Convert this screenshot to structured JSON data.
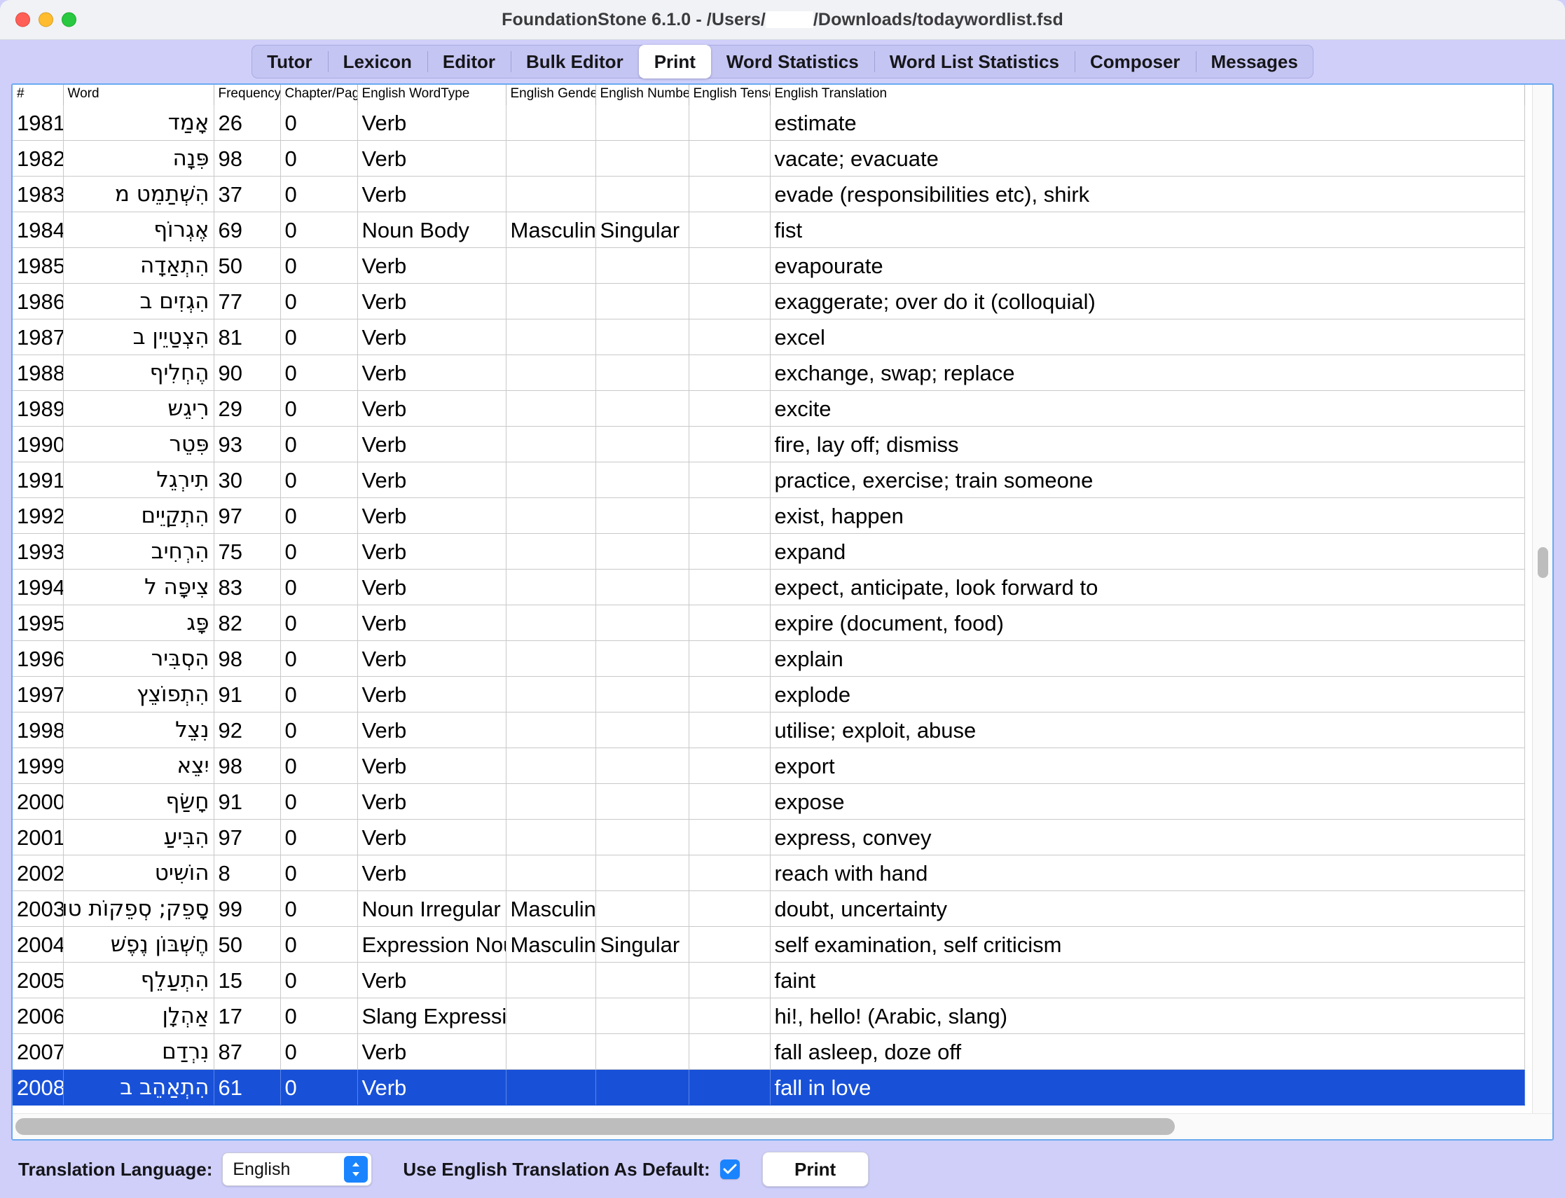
{
  "window": {
    "title_prefix": "FoundationStone 6.1.0 - /Users/",
    "title_suffix": "/Downloads/todaywordlist.fsd",
    "traffic_lights": [
      "close",
      "minimize",
      "zoom"
    ]
  },
  "tabs": [
    {
      "label": "Tutor",
      "active": false
    },
    {
      "label": "Lexicon",
      "active": false
    },
    {
      "label": "Editor",
      "active": false
    },
    {
      "label": "Bulk Editor",
      "active": false
    },
    {
      "label": "Print",
      "active": true
    },
    {
      "label": "Word Statistics",
      "active": false
    },
    {
      "label": "Word List Statistics",
      "active": false
    },
    {
      "label": "Composer",
      "active": false
    },
    {
      "label": "Messages",
      "active": false
    }
  ],
  "table": {
    "columns": [
      "#",
      "Word",
      "Frequency",
      "Chapter/Page",
      "English WordType",
      "English Gender",
      "English Number",
      "English Tense",
      "English Translation"
    ],
    "rows": [
      {
        "num": "1981",
        "word": "אָמַד",
        "freq": "26",
        "chap": "0",
        "type": "Verb",
        "gender": "",
        "number": "",
        "tense": "",
        "translation": "estimate",
        "selected": false
      },
      {
        "num": "1982",
        "word": "פִּנָה",
        "freq": "98",
        "chap": "0",
        "type": "Verb",
        "gender": "",
        "number": "",
        "tense": "",
        "translation": "vacate; evacuate",
        "selected": false
      },
      {
        "num": "1983",
        "word": "הִשְׁתַמֵט מ",
        "freq": "37",
        "chap": "0",
        "type": "Verb",
        "gender": "",
        "number": "",
        "tense": "",
        "translation": "evade (responsibilities etc), shirk",
        "selected": false
      },
      {
        "num": "1984",
        "word": "אֶגְרוֹף",
        "freq": "69",
        "chap": "0",
        "type": "Noun Body",
        "gender": "Masculine",
        "number": "Singular",
        "tense": "",
        "translation": "fist",
        "selected": false
      },
      {
        "num": "1985",
        "word": "הִתְאַדָה",
        "freq": "50",
        "chap": "0",
        "type": "Verb",
        "gender": "",
        "number": "",
        "tense": "",
        "translation": "evapourate",
        "selected": false
      },
      {
        "num": "1986",
        "word": "הִגְזִים ב",
        "freq": "77",
        "chap": "0",
        "type": "Verb",
        "gender": "",
        "number": "",
        "tense": "",
        "translation": "exaggerate; over do it (colloquial)",
        "selected": false
      },
      {
        "num": "1987",
        "word": "הִצְטַיֵין ב",
        "freq": "81",
        "chap": "0",
        "type": "Verb",
        "gender": "",
        "number": "",
        "tense": "",
        "translation": "excel",
        "selected": false
      },
      {
        "num": "1988",
        "word": "הֶחְלִיף",
        "freq": "90",
        "chap": "0",
        "type": "Verb",
        "gender": "",
        "number": "",
        "tense": "",
        "translation": "exchange, swap; replace",
        "selected": false
      },
      {
        "num": "1989",
        "word": "רִיגֵש",
        "freq": "29",
        "chap": "0",
        "type": "Verb",
        "gender": "",
        "number": "",
        "tense": "",
        "translation": "excite",
        "selected": false
      },
      {
        "num": "1990",
        "word": "פִּטֵר",
        "freq": "93",
        "chap": "0",
        "type": "Verb",
        "gender": "",
        "number": "",
        "tense": "",
        "translation": "fire, lay off; dismiss",
        "selected": false
      },
      {
        "num": "1991",
        "word": "תִירְגֵל",
        "freq": "30",
        "chap": "0",
        "type": "Verb",
        "gender": "",
        "number": "",
        "tense": "",
        "translation": "practice, exercise; train someone",
        "selected": false
      },
      {
        "num": "1992",
        "word": "הִתְקַיֵים",
        "freq": "97",
        "chap": "0",
        "type": "Verb",
        "gender": "",
        "number": "",
        "tense": "",
        "translation": "exist, happen",
        "selected": false
      },
      {
        "num": "1993",
        "word": "הִרְחִיב",
        "freq": "75",
        "chap": "0",
        "type": "Verb",
        "gender": "",
        "number": "",
        "tense": "",
        "translation": "expand",
        "selected": false
      },
      {
        "num": "1994",
        "word": "צִיפָּה ל",
        "freq": "83",
        "chap": "0",
        "type": "Verb",
        "gender": "",
        "number": "",
        "tense": "",
        "translation": "expect, anticipate, look forward to",
        "selected": false
      },
      {
        "num": "1995",
        "word": "פָּג",
        "freq": "82",
        "chap": "0",
        "type": "Verb",
        "gender": "",
        "number": "",
        "tense": "",
        "translation": "expire (document, food)",
        "selected": false
      },
      {
        "num": "1996",
        "word": "הִסְבִּיר",
        "freq": "98",
        "chap": "0",
        "type": "Verb",
        "gender": "",
        "number": "",
        "tense": "",
        "translation": "explain",
        "selected": false
      },
      {
        "num": "1997",
        "word": "הִתְפוֹצֵץ",
        "freq": "91",
        "chap": "0",
        "type": "Verb",
        "gender": "",
        "number": "",
        "tense": "",
        "translation": "explode",
        "selected": false
      },
      {
        "num": "1998",
        "word": "נִצֵל",
        "freq": "92",
        "chap": "0",
        "type": "Verb",
        "gender": "",
        "number": "",
        "tense": "",
        "translation": "utilise; exploit, abuse",
        "selected": false
      },
      {
        "num": "1999",
        "word": "יִצֵא",
        "freq": "98",
        "chap": "0",
        "type": "Verb",
        "gender": "",
        "number": "",
        "tense": "",
        "translation": "export",
        "selected": false
      },
      {
        "num": "2000",
        "word": "חָשַׂף",
        "freq": "91",
        "chap": "0",
        "type": "Verb",
        "gender": "",
        "number": "",
        "tense": "",
        "translation": "expose",
        "selected": false
      },
      {
        "num": "2001",
        "word": "הִבִּיעַ",
        "freq": "97",
        "chap": "0",
        "type": "Verb",
        "gender": "",
        "number": "",
        "tense": "",
        "translation": "express, convey",
        "selected": false
      },
      {
        "num": "2002",
        "word": "הוֹשִיט",
        "freq": "8",
        "chap": "0",
        "type": "Verb",
        "gender": "",
        "number": "",
        "tense": "",
        "translation": "reach with hand",
        "selected": false
      },
      {
        "num": "2003",
        "word": "סָפֵק; סְפֵקוֹת טוֹבִים",
        "freq": "99",
        "chap": "0",
        "type": "Noun Irregular",
        "gender": "Masculine",
        "number": "",
        "tense": "",
        "translation": "doubt, uncertainty",
        "selected": false
      },
      {
        "num": "2004",
        "word": "חֶשְׁבּוֹן נֶפֶשׁ",
        "freq": "50",
        "chap": "0",
        "type": "Expression Noun",
        "gender": "Masculine",
        "number": "Singular",
        "tense": "",
        "translation": "self examination, self criticism",
        "selected": false
      },
      {
        "num": "2005",
        "word": "הִתְעַלֵף",
        "freq": "15",
        "chap": "0",
        "type": "Verb",
        "gender": "",
        "number": "",
        "tense": "",
        "translation": "faint",
        "selected": false
      },
      {
        "num": "2006",
        "word": "אַהְלָן",
        "freq": "17",
        "chap": "0",
        "type": "Slang Expression",
        "gender": "",
        "number": "",
        "tense": "",
        "translation": "hi!, hello! (Arabic, slang)",
        "selected": false
      },
      {
        "num": "2007",
        "word": "נִרְדַם",
        "freq": "87",
        "chap": "0",
        "type": "Verb",
        "gender": "",
        "number": "",
        "tense": "",
        "translation": "fall asleep, doze off",
        "selected": false
      },
      {
        "num": "2008",
        "word": "הִתְאַהֵב ב",
        "freq": "61",
        "chap": "0",
        "type": "Verb",
        "gender": "",
        "number": "",
        "tense": "",
        "translation": "fall in love",
        "selected": true
      }
    ]
  },
  "footer": {
    "translation_language_label": "Translation Language:",
    "translation_language_value": "English",
    "use_default_label": "Use English Translation As Default:",
    "use_default_checked": true,
    "print_label": "Print"
  },
  "colors": {
    "accent_blue": "#1a84ff",
    "selection_blue": "#1851d8",
    "chrome_lavender": "#cfcffa",
    "panel_border": "#6aa9f0"
  }
}
